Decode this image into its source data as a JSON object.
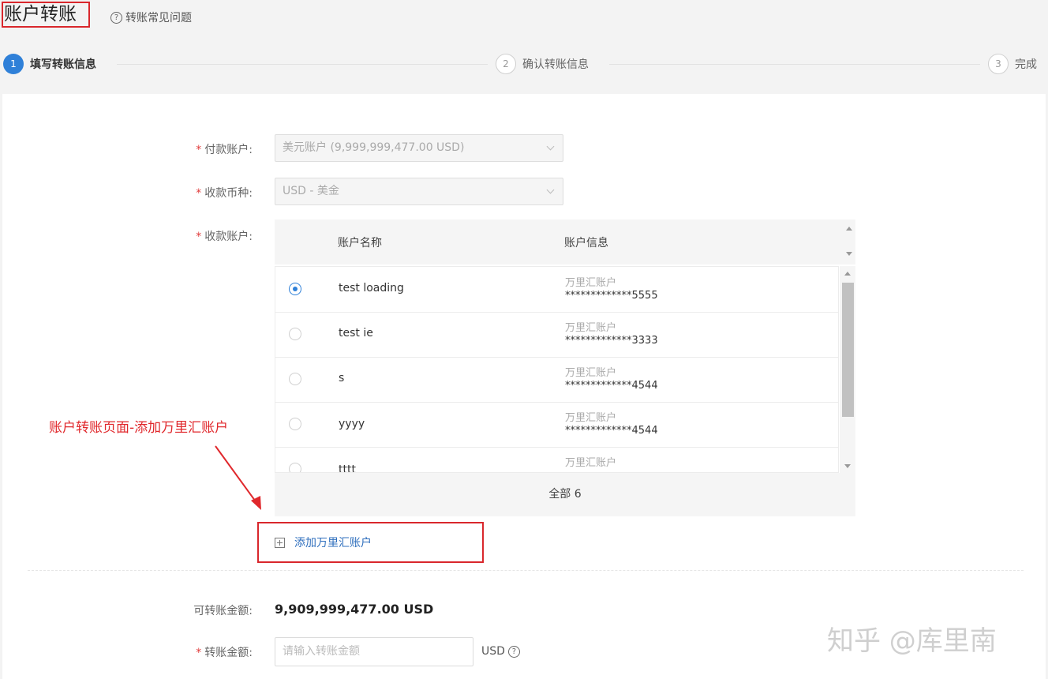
{
  "header": {
    "title": "账户转账",
    "faq_icon": "?",
    "faq_label": "转账常见问题"
  },
  "steps": [
    {
      "number": "1",
      "label": "填写转账信息",
      "state": "active"
    },
    {
      "number": "2",
      "label": "确认转账信息",
      "state": "inactive"
    },
    {
      "number": "3",
      "label": "完成",
      "state": "inactive"
    }
  ],
  "form": {
    "required_mark": "*",
    "payer_label": "付款账户:",
    "payer_value": "美元账户 (9,999,999,477.00 USD)",
    "currency_label": "收款币种:",
    "currency_value": "USD - 美金",
    "payee_label": "收款账户:",
    "available_label": "可转账金额:",
    "available_value": "9,909,999,477.00 USD",
    "amount_label": "转账金额:",
    "amount_placeholder": "请输入转账金额",
    "amount_unit": "USD",
    "amount_help_icon": "?"
  },
  "table": {
    "col_name": "账户名称",
    "col_info": "账户信息",
    "rows": [
      {
        "name": "test loading",
        "info_type": "万里汇账户",
        "info_number": "*************5555",
        "selected": true
      },
      {
        "name": "test ie",
        "info_type": "万里汇账户",
        "info_number": "*************3333",
        "selected": false
      },
      {
        "name": "s",
        "info_type": "万里汇账户",
        "info_number": "*************4544",
        "selected": false
      },
      {
        "name": "yyyy",
        "info_type": "万里汇账户",
        "info_number": "*************4544",
        "selected": false
      },
      {
        "name": "tttt",
        "info_type": "万里汇账户",
        "info_number": "",
        "selected": false
      }
    ],
    "footer": "全部 6"
  },
  "add_account": {
    "label": "添加万里汇账户"
  },
  "annotation": "账户转账页面-添加万里汇账户",
  "watermark": "知乎 @库里南",
  "colors": {
    "accent": "#2f80d8",
    "highlight": "#d9272c",
    "link": "#2f6fbd"
  }
}
